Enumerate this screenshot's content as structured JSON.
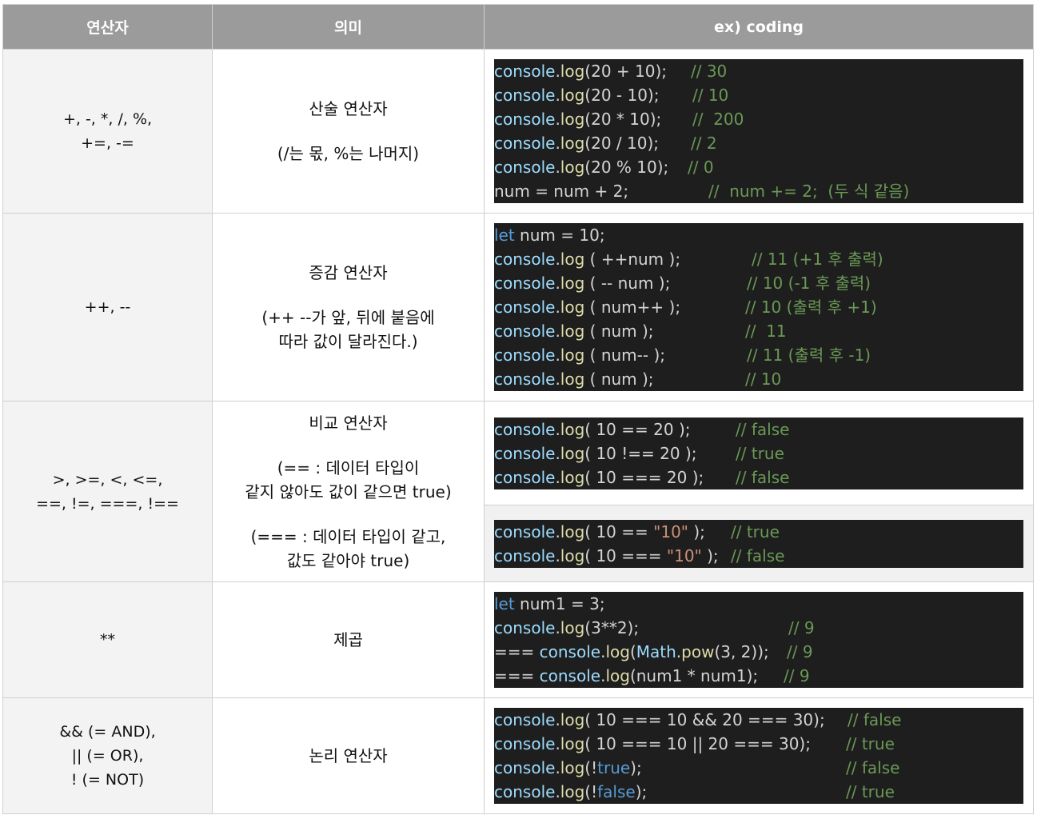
{
  "header": {
    "col1": "연산자",
    "col2": "의미",
    "col3": "ex) coding"
  },
  "rows": [
    {
      "operators": "+,  -,  *,  /,  %,\n+=,  -=",
      "meaning": [
        "산술 연산자",
        "",
        "(/는 몫, %는 나머지)"
      ],
      "code_blocks": [
        [
          {
            "code": "console.log(20 + 10);",
            "comment": "// 30"
          },
          {
            "code": "console.log(20 - 10);",
            "comment": "// 10"
          },
          {
            "code": "console.log(20 * 10);",
            "comment": "//  200"
          },
          {
            "code": "console.log(20 / 10);",
            "comment": "// 2"
          },
          {
            "code": "console.log(20 % 10);",
            "comment": "// 0"
          },
          {
            "code": "num = num + 2;",
            "comment": "//  num += 2;  (두 식 같음)"
          }
        ]
      ]
    },
    {
      "operators": "++,  --",
      "meaning": [
        "증감 연산자",
        "",
        "(++ --가 앞, 뒤에 붙음에",
        "따라 값이 달라진다.)"
      ],
      "code_blocks": [
        [
          {
            "code": "let num = 10;",
            "comment": ""
          },
          {
            "code": "console.log ( ++num );",
            "comment": "// 11 (+1 후 출력)"
          },
          {
            "code": "console.log ( -- num );",
            "comment": "// 10 (-1 후 출력)"
          },
          {
            "code": "console.log ( num++ );",
            "comment": "// 10 (출력 후 +1)"
          },
          {
            "code": "console.log ( num );",
            "comment": "//  11"
          },
          {
            "code": "console.log ( num-- );",
            "comment": "// 11 (출력 후 -1)"
          },
          {
            "code": "console.log ( num );",
            "comment": "// 10"
          }
        ]
      ]
    },
    {
      "operators": ">,  >=,  <,  <=,\n==,  !=,  ===,  !==",
      "meaning": [
        "비교 연산자",
        "",
        "(== : 데이터 타입이",
        "같지 않아도 값이 같으면 true)",
        "",
        "(=== : 데이터 타입이 같고,",
        "값도 같아야 true)"
      ],
      "code_blocks": [
        [
          {
            "code": "console.log( 10 == 20 );",
            "comment": "// false"
          },
          {
            "code": "console.log( 10 !== 20 );",
            "comment": "// true"
          },
          {
            "code": "console.log( 10 === 20 );",
            "comment": "// false"
          }
        ],
        [
          {
            "code": "console.log( 10 == \"10\" );",
            "comment": "// true"
          },
          {
            "code": "console.log( 10 === \"10\" );",
            "comment": "// false"
          }
        ]
      ]
    },
    {
      "operators": "**",
      "meaning": [
        "제곱"
      ],
      "code_blocks": [
        [
          {
            "code": "let num1 = 3;",
            "comment": ""
          },
          {
            "code": "console.log(3**2);",
            "comment": "// 9"
          },
          {
            "code": "=== console.log(Math.pow(3, 2));",
            "comment": "// 9"
          },
          {
            "code": "=== console.log(num1 * num1);",
            "comment": "// 9"
          }
        ]
      ]
    },
    {
      "operators": "&& (= AND),\n|| (= OR),\n! (= NOT)",
      "meaning": [
        "논리 연산자"
      ],
      "code_blocks": [
        [
          {
            "code": "console.log( 10 === 10 && 20 === 30);",
            "comment": "// false"
          },
          {
            "code": "console.log( 10 === 10 || 20 === 30);",
            "comment": "// true"
          },
          {
            "code": "console.log(!true);",
            "comment": "// false"
          },
          {
            "code": "console.log(!false);",
            "comment": "// true"
          }
        ]
      ]
    }
  ]
}
